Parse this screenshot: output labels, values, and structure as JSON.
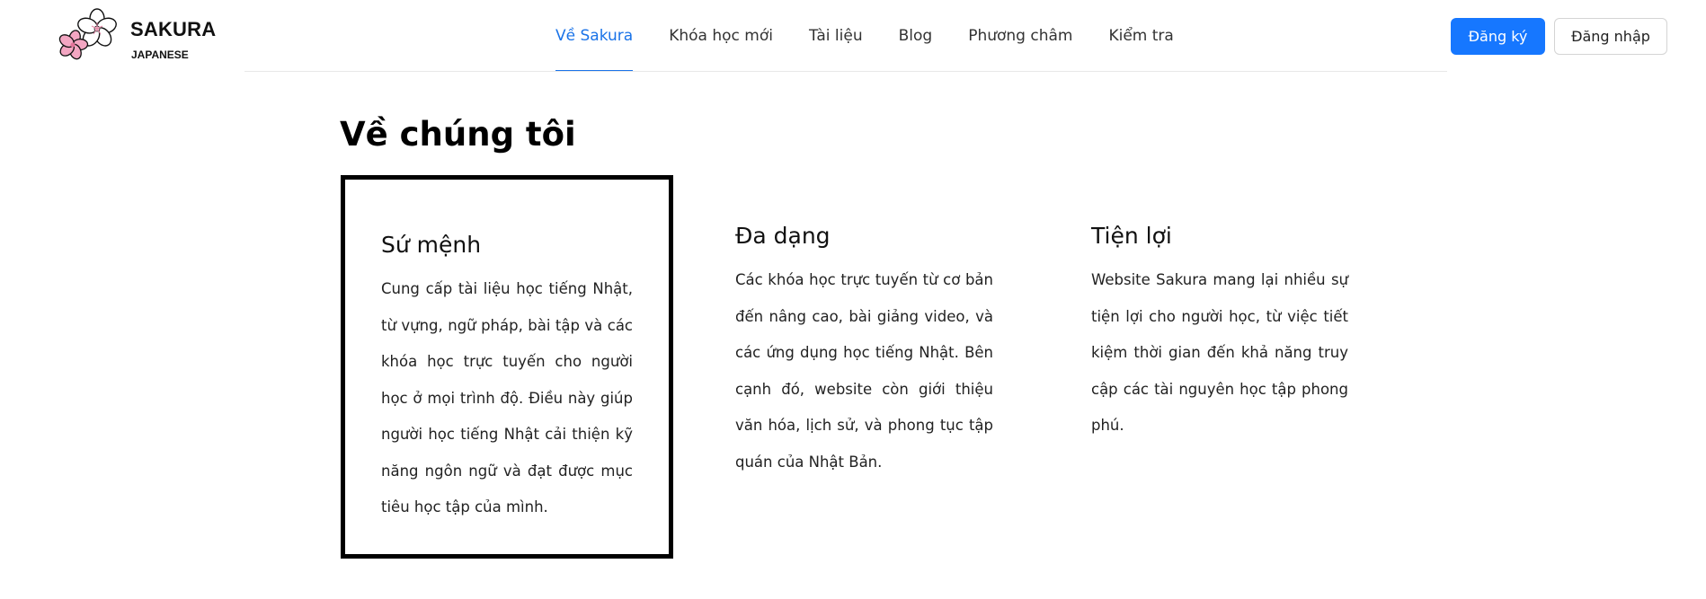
{
  "header": {
    "logo": {
      "title": "SAKURA",
      "subtitle": "JAPANESE"
    },
    "nav": [
      {
        "label": "Về Sakura",
        "active": true
      },
      {
        "label": "Khóa học mới",
        "active": false
      },
      {
        "label": "Tài liệu",
        "active": false
      },
      {
        "label": "Blog",
        "active": false
      },
      {
        "label": "Phương châm",
        "active": false
      },
      {
        "label": "Kiểm tra",
        "active": false
      }
    ],
    "register_label": "Đăng ký",
    "login_label": "Đăng nhập"
  },
  "main": {
    "title": "Về chúng tôi",
    "cards": [
      {
        "title": "Sứ mệnh",
        "text": "Cung cấp tài liệu học tiếng Nhật, từ vựng, ngữ pháp, bài tập và các khóa học trực tuyến cho người học ở mọi trình độ. Điều này giúp người học tiếng Nhật cải thiện kỹ năng ngôn ngữ và đạt được mục tiêu học tập của mình."
      },
      {
        "title": "Đa dạng",
        "text": "Các khóa học trực tuyến từ cơ bản đến nâng cao, bài giảng video, và các ứng dụng học tiếng Nhật. Bên cạnh đó, website còn giới thiệu văn hóa, lịch sử, và phong tục tập quán của Nhật Bản."
      },
      {
        "title": "Tiện lợi",
        "text": "Website Sakura mang lại nhiều sự tiện lợi cho người học, từ việc tiết kiệm thời gian đến khả năng truy cập các tài nguyên học tập phong phú."
      }
    ]
  },
  "colors": {
    "accent": "#1677ff",
    "nav_active": "#1a73e8",
    "flower_pink": "#f3a6c2",
    "flower_white": "#ffffff"
  },
  "icons": {
    "logo": "sakura-flower-icon"
  }
}
